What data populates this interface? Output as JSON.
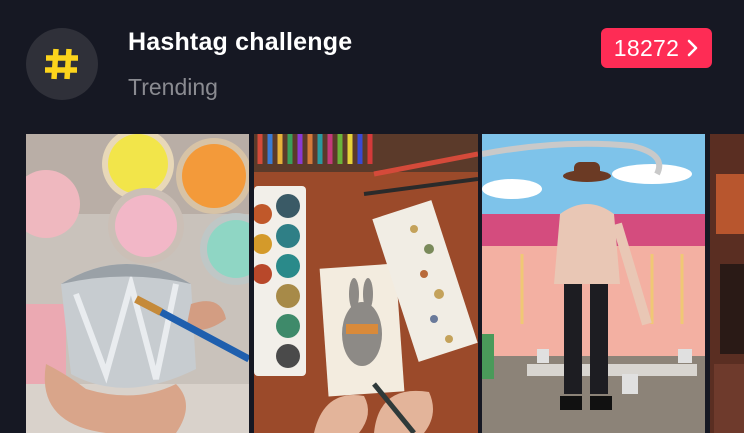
{
  "challenge": {
    "icon": "hashtag-icon",
    "title": "Hashtag challenge",
    "subtitle": "Trending",
    "count": "18272",
    "count_icon": "chevron-right-icon"
  },
  "colors": {
    "background": "#161823",
    "avatar_bg": "#2f3039",
    "hashtag_yellow": "#fcd41c",
    "badge_red": "#fe2c55",
    "subtitle_gray": "#8a8b91"
  },
  "thumbnails": [
    {
      "subject": "painting a ceramic pot with pastel paints"
    },
    {
      "subject": "watercolor palette and rabbit illustration"
    },
    {
      "subject": "person painting a mural on a wall"
    },
    {
      "subject": "partially visible fourth video"
    }
  ]
}
